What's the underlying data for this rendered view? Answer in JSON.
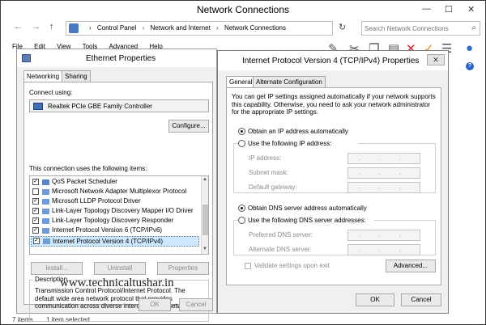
{
  "net_window": {
    "title": "Network Connections",
    "caption_minimize": "—",
    "caption_maximize": "☐",
    "caption_close": "✕",
    "nav_back": "←",
    "nav_forward": "→",
    "nav_up": "↑",
    "breadcrumbs": [
      "Control Panel",
      "Network and Internet",
      "Network Connections"
    ],
    "breadcrumb_separator": "›",
    "address_dropdown": "∨",
    "refresh": "↻",
    "search_placeholder": "Search Network Connections",
    "search_icon": "⌕",
    "menu": [
      "File",
      "Edit",
      "View",
      "Tools",
      "Advanced",
      "Help"
    ],
    "status_left": "7 items",
    "status_mid": "1 item selected"
  },
  "ethernet_props": {
    "title": "Ethernet Properties",
    "tabs": [
      "Networking",
      "Sharing"
    ],
    "connect_using_label": "Connect using:",
    "adapter_name": "Realtek PCIe GBE Family Controller",
    "configure_button": "Configure...",
    "items_label": "This connection uses the following items:",
    "items": [
      {
        "label": "QoS Packet Scheduler",
        "checked": true
      },
      {
        "label": "Microsoft Network Adapter Multiplexor Protocol",
        "checked": false
      },
      {
        "label": "Microsoft LLDP Protocol Driver",
        "checked": true
      },
      {
        "label": "Link-Layer Topology Discovery Mapper I/O Driver",
        "checked": true
      },
      {
        "label": "Link-Layer Topology Discovery Responder",
        "checked": true
      },
      {
        "label": "Internet Protocol Version 6 (TCP/IPv6)",
        "checked": true
      },
      {
        "label": "Internet Protocol Version 4 (TCP/IPv4)",
        "checked": true
      }
    ],
    "check_mark": "✓",
    "install_button": "Install...",
    "uninstall_button": "Uninstall",
    "properties_button": "Properties",
    "description_title": "Description",
    "description_text": "Transmission Control Protocol/Internet Protocol. The default wide area network protocol that provides communication across diverse interconnected networks.",
    "ok_button": "OK",
    "cancel_button": "Cancel"
  },
  "ipv4_props": {
    "title": "Internet Protocol Version 4 (TCP/IPv4) Properties",
    "close_glyph": "✕",
    "tabs": [
      "General",
      "Alternate Configuration"
    ],
    "intro_text": "You can get IP settings assigned automatically if your network supports this capability. Otherwise, you need to ask your network administrator for the appropriate IP settings.",
    "obtain_ip_auto": "Obtain an IP address automatically",
    "use_following_ip": "Use the following IP address:",
    "ip_address_label": "IP address:",
    "subnet_mask_label": "Subnet mask:",
    "default_gateway_label": "Default gateway:",
    "ip_placeholder": ". . .",
    "obtain_dns_auto": "Obtain DNS server address automatically",
    "use_following_dns": "Use the following DNS server addresses:",
    "preferred_dns_label": "Preferred DNS server:",
    "alternate_dns_label": "Alternate DNS server:",
    "validate_label": "Validate settings upon exit",
    "advanced_button": "Advanced...",
    "ok_button": "OK",
    "cancel_button": "Cancel"
  },
  "watermark": "www.technicaltushar.in",
  "colors": {
    "selected_row": "#cde8ff",
    "highlight_border": "#3c7fd8",
    "dialog_bg": "#f0f0f0",
    "delete_icon": "#d62b2b",
    "check_icon": "#e88a1c",
    "globe_icon": "#2b6fcf"
  },
  "icons": {
    "toolbar": [
      "pin-icon",
      "cut-icon",
      "copy-icon",
      "paste-icon",
      "delete-icon",
      "check-icon",
      "properties-icon",
      "globe-icon"
    ],
    "help": "?"
  }
}
